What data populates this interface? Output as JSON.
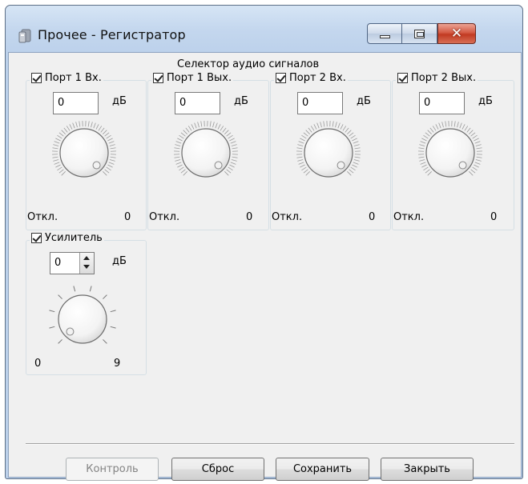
{
  "window": {
    "title": "Прочее - Регистратор"
  },
  "section_title": "Селектор аудио сигналов",
  "ports": [
    {
      "label": "Порт 1 Вх.",
      "value": "0",
      "unit": "дБ",
      "min_label": "Откл.",
      "max_label": "0",
      "checked": true
    },
    {
      "label": "Порт 1 Вых.",
      "value": "0",
      "unit": "дБ",
      "min_label": "Откл.",
      "max_label": "0",
      "checked": true
    },
    {
      "label": "Порт 2 Вх.",
      "value": "0",
      "unit": "дБ",
      "min_label": "Откл.",
      "max_label": "0",
      "checked": true
    },
    {
      "label": "Порт 2 Вых.",
      "value": "0",
      "unit": "дБ",
      "min_label": "Откл.",
      "max_label": "0",
      "checked": true
    }
  ],
  "amplifier": {
    "label": "Усилитель",
    "value": "0",
    "unit": "дБ",
    "min_label": "0",
    "max_label": "9",
    "checked": true
  },
  "buttons": {
    "control": "Контроль",
    "reset": "Сброс",
    "save": "Сохранить",
    "close": "Закрыть"
  },
  "colors": {
    "titlebar": "#c4d7ee",
    "close_button": "#c94a33",
    "client_bg": "#f0f0f0"
  }
}
